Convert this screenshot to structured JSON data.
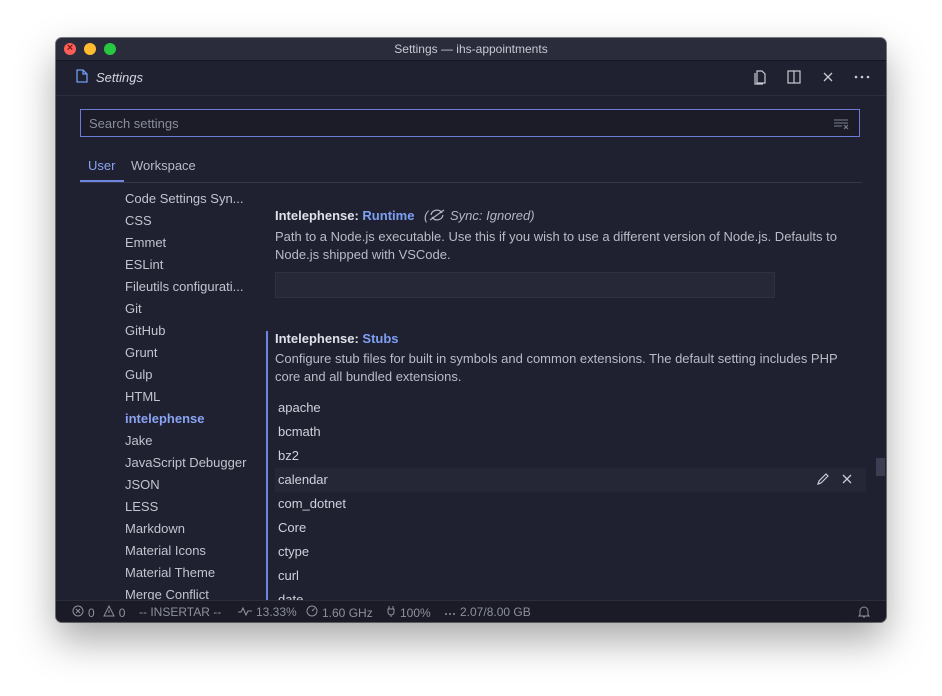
{
  "window": {
    "title": "Settings — ihs-appointments"
  },
  "tab": {
    "label": "Settings"
  },
  "search": {
    "placeholder": "Search settings",
    "value": ""
  },
  "scope_tabs": {
    "user": "User",
    "workspace": "Workspace"
  },
  "toc": {
    "items": [
      "Code Settings Syn...",
      "CSS",
      "Emmet",
      "ESLint",
      "Fileutils configurati...",
      "Git",
      "GitHub",
      "Grunt",
      "Gulp",
      "HTML",
      "intelephense",
      "Jake",
      "JavaScript Debugger",
      "JSON",
      "LESS",
      "Markdown",
      "Material Icons",
      "Material Theme",
      "Merge Conflict"
    ],
    "active": "intelephense"
  },
  "runtime": {
    "prefix": "Intelephense: ",
    "key": "Runtime",
    "sync": "Sync: Ignored)",
    "sync_open": "(",
    "description": "Path to a Node.js executable. Use this if you wish to use a different version of Node.js. Defaults to Node.js shipped with VSCode.",
    "value": ""
  },
  "stubs": {
    "prefix": "Intelephense: ",
    "key": "Stubs",
    "description": "Configure stub files for built in symbols and common extensions. The default setting includes PHP core and all bundled extensions.",
    "items": [
      "apache",
      "bcmath",
      "bz2",
      "calendar",
      "com_dotnet",
      "Core",
      "ctype",
      "curl",
      "date"
    ],
    "hovered": "calendar"
  },
  "statusbar": {
    "errors": "0",
    "warnings": "0",
    "mode": "-- INSERTAR --",
    "cpu": "13.33%",
    "freq": "1.60 GHz",
    "battery": "100%",
    "memory": "2.07/8.00 GB"
  },
  "colors": {
    "accent": "#6f86e0",
    "background": "#1f2130",
    "active_text": "#8aa2f2"
  }
}
